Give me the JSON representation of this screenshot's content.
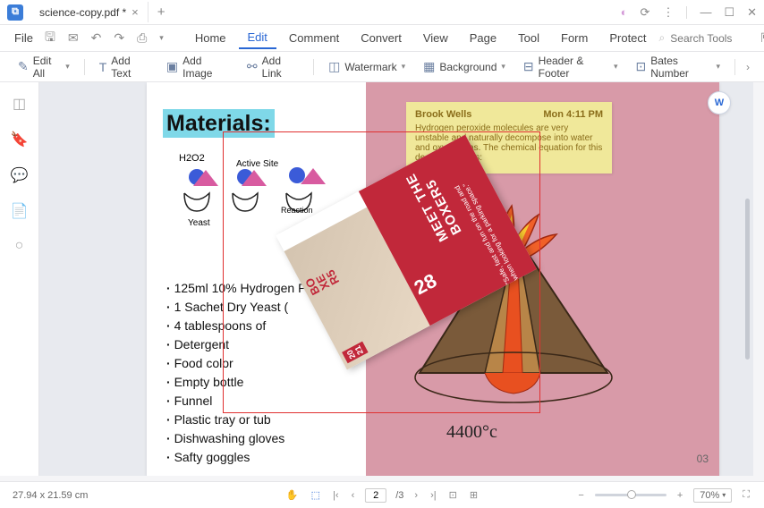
{
  "title": {
    "filename": "science-copy.pdf *"
  },
  "menu": {
    "file": "File",
    "home": "Home",
    "edit": "Edit",
    "comment": "Comment",
    "convert": "Convert",
    "view": "View",
    "page": "Page",
    "tool": "Tool",
    "form": "Form",
    "protect": "Protect",
    "search_ph": "Search Tools"
  },
  "toolbar": {
    "edit_all": "Edit All",
    "add_text": "Add Text",
    "add_image": "Add Image",
    "add_link": "Add Link",
    "watermark": "Watermark",
    "background": "Background",
    "header_footer": "Header & Footer",
    "bates": "Bates Number"
  },
  "doc": {
    "materials_heading": "Materials:",
    "sketch": {
      "h2o2": "H2O2",
      "active_site": "Active Site",
      "yeast": "Yeast",
      "reaction": "Reaction"
    },
    "items": [
      "125ml 10% Hydrogen P",
      "1 Sachet Dry Yeast (",
      "4 tablespoons of",
      "Detergent",
      "Food color",
      "Empty bottle",
      "Funnel",
      "Plastic tray or tub",
      "Dishwashing gloves",
      "Safty goggles"
    ],
    "page_number": "03",
    "temperature": "4400°c"
  },
  "sticky": {
    "author": "Brook Wells",
    "time": "Mon 4:11 PM",
    "body": "Hydrogen peroxide molecules are very unstable and naturally decompose into water and oxygen gas. The chemical equation for this decompostion is:"
  },
  "flyer": {
    "title1": "MEET THE",
    "title2": "BOXER5",
    "quote": "\"Safe, fast and fun on the road and when looking for a parking space.\"",
    "num": "28",
    "side": "BO\nXE\nR5",
    "year": "20\n21"
  },
  "status": {
    "dims": "27.94 x 21.59 cm",
    "page": "2",
    "total": "/3",
    "zoom": "70%"
  },
  "word_badge": "W"
}
